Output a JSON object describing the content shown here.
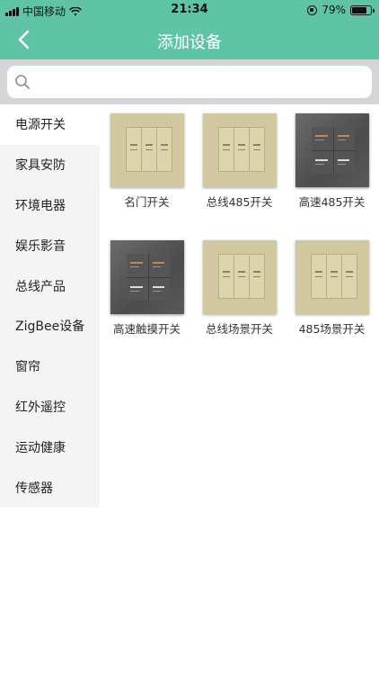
{
  "status_bar": {
    "carrier": "中国移动",
    "time": "21:34",
    "battery": "79%",
    "battery_level": 0.79
  },
  "nav": {
    "title": "添加设备",
    "back_icon": "chevron-left-icon"
  },
  "search": {
    "placeholder": "",
    "value": "",
    "icon": "search-icon"
  },
  "sidebar": {
    "items": [
      {
        "label": "电源开关",
        "active": true
      },
      {
        "label": "家具安防"
      },
      {
        "label": "环境电器"
      },
      {
        "label": "娱乐影音"
      },
      {
        "label": "总线产品"
      },
      {
        "label": "ZigBee设备"
      },
      {
        "label": "窗帘"
      },
      {
        "label": "红外遥控"
      },
      {
        "label": "运动健康"
      },
      {
        "label": "传感器"
      }
    ]
  },
  "devices": [
    {
      "label": "名门开关",
      "style": "beige-3key"
    },
    {
      "label": "总线485开关",
      "style": "beige-3key"
    },
    {
      "label": "高速485开关",
      "style": "grey-4key"
    },
    {
      "label": "高速触摸开关",
      "style": "grey-4key"
    },
    {
      "label": "总线场景开关",
      "style": "beige-3key"
    },
    {
      "label": "485场景开关",
      "style": "beige-3key"
    }
  ],
  "colors": {
    "accent": "#5fc4a6",
    "search_bg": "#d5d5d7",
    "sidebar_bg": "#f4f4f4",
    "panel_beige": "#d2c8a0",
    "panel_grey": "#555555"
  }
}
